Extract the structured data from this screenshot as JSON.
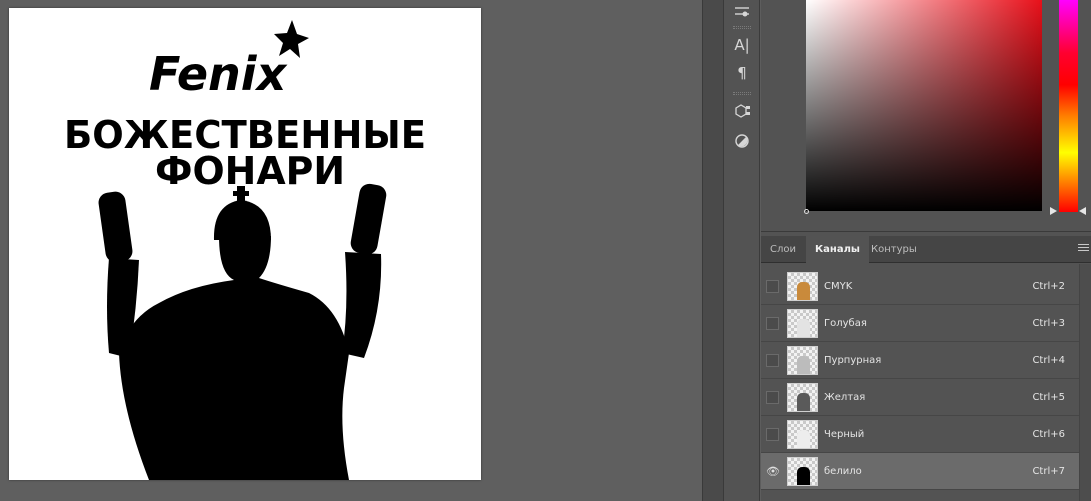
{
  "canvas": {
    "logo_text": "Fenix",
    "headline_line1": "БОЖЕСТВЕННЫЕ",
    "headline_line2": "ФОНАРИ"
  },
  "toolbar": {
    "icons": [
      "adjust-icon",
      "character-icon",
      "paragraph-icon",
      "3d-icon",
      "contrast-icon"
    ],
    "character_glyph": "A|",
    "paragraph_glyph": "¶"
  },
  "color_picker": {
    "hue_color": "#e8101a"
  },
  "panel": {
    "tabs": [
      {
        "label": "Слои",
        "active": false
      },
      {
        "label": "Каналы",
        "active": true
      },
      {
        "label": "Контуры",
        "active": false
      }
    ]
  },
  "channels": [
    {
      "name": "CMYK",
      "shortcut": "Ctrl+2",
      "visible": false,
      "thumb_color": "#c98a3b"
    },
    {
      "name": "Голубая",
      "shortcut": "Ctrl+3",
      "visible": false,
      "thumb_color": "#e3e3e3"
    },
    {
      "name": "Пурпурная",
      "shortcut": "Ctrl+4",
      "visible": false,
      "thumb_color": "#bcbcbc"
    },
    {
      "name": "Желтая",
      "shortcut": "Ctrl+5",
      "visible": false,
      "thumb_color": "#5a5a5a"
    },
    {
      "name": "Черный",
      "shortcut": "Ctrl+6",
      "visible": false,
      "thumb_color": "#ededed"
    },
    {
      "name": "белило",
      "shortcut": "Ctrl+7",
      "visible": true,
      "thumb_color": "#000000"
    }
  ]
}
